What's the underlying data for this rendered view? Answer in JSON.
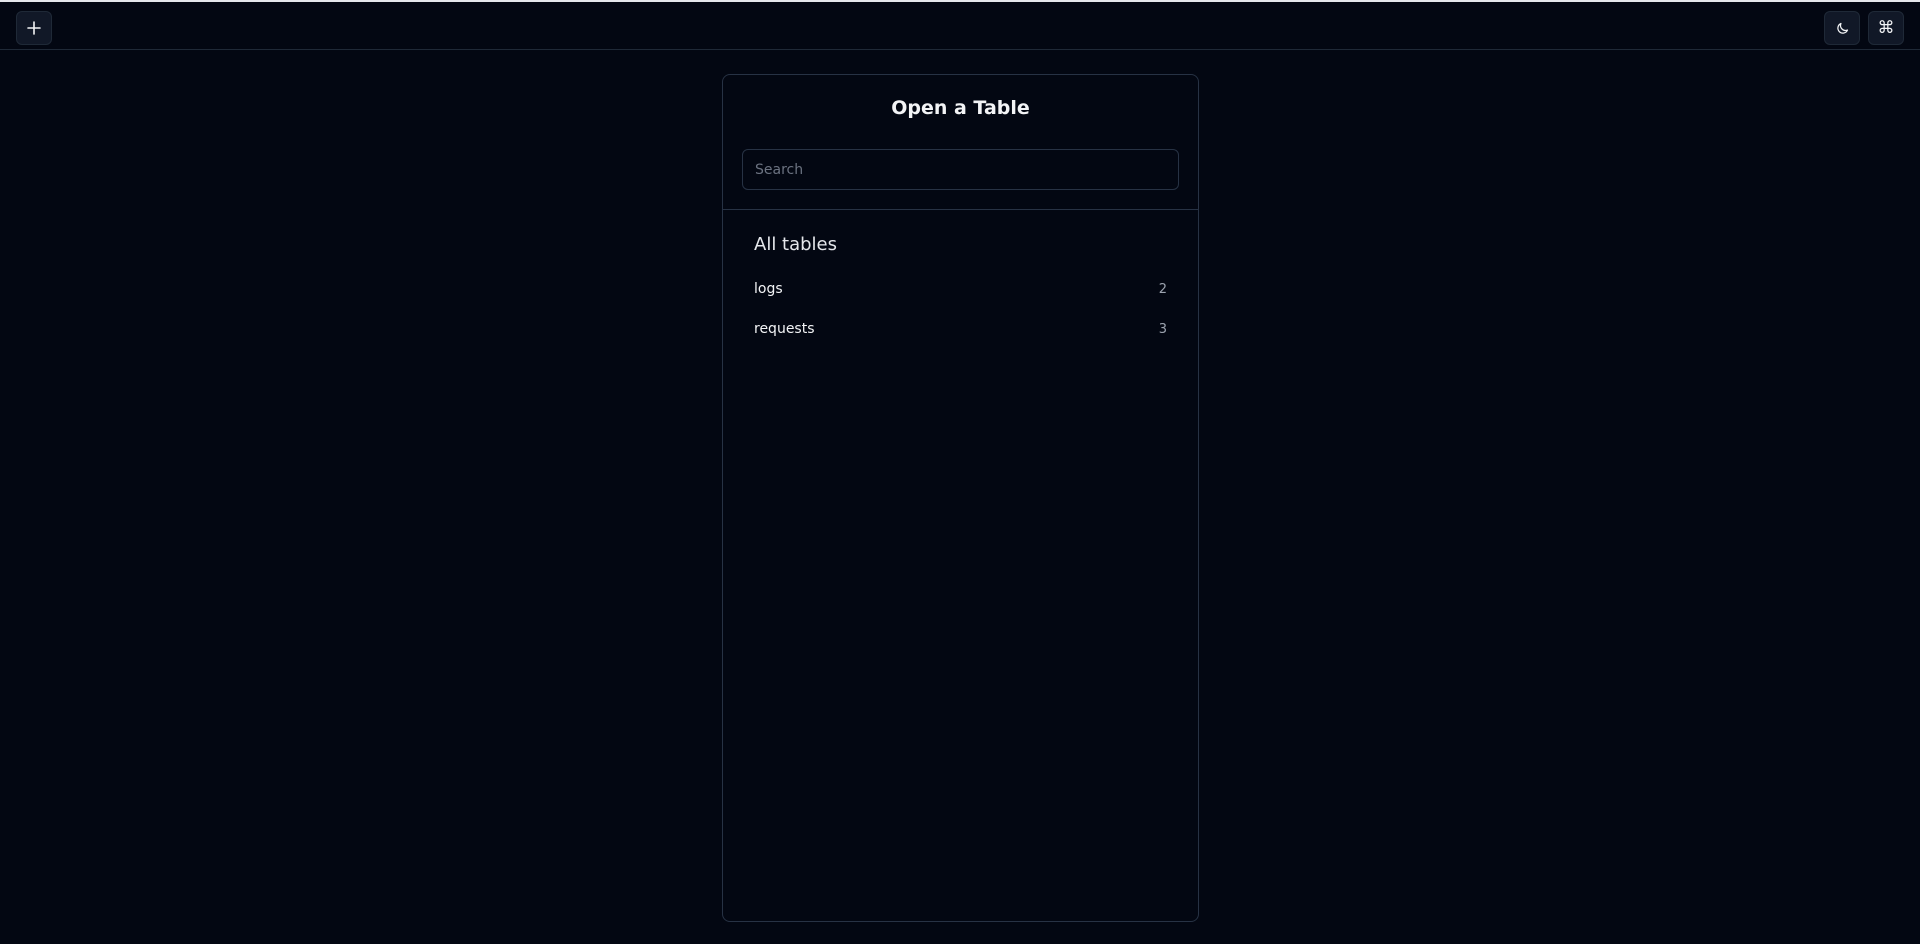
{
  "toolbar": {
    "add_icon": "plus-icon",
    "theme_icon": "moon-icon",
    "command_icon": "⌘"
  },
  "panel": {
    "title": "Open a Table",
    "search": {
      "placeholder": "Search",
      "value": ""
    },
    "section_title": "All tables",
    "tables": [
      {
        "name": "logs",
        "count": "2"
      },
      {
        "name": "requests",
        "count": "3"
      }
    ]
  }
}
